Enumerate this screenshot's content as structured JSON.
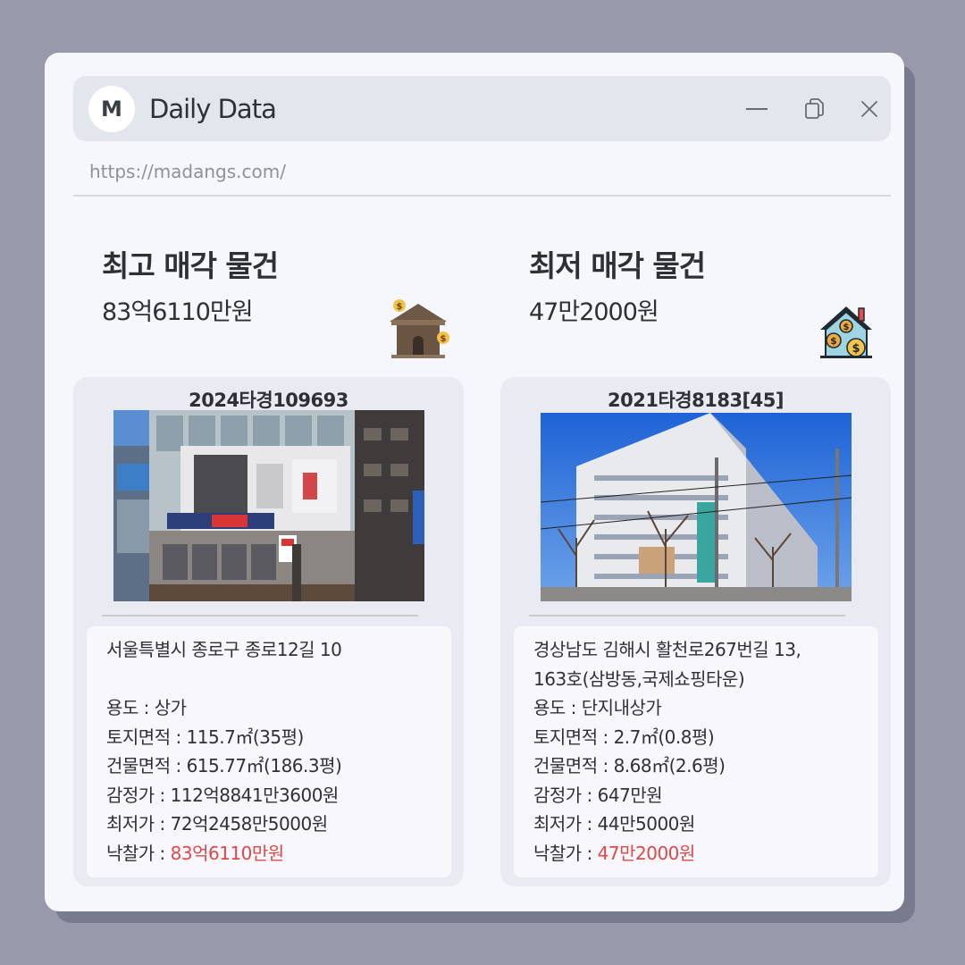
{
  "window": {
    "logo_letter": "M",
    "title": "Daily Data",
    "url": "https://madangs.com/"
  },
  "highest": {
    "title": "최고 매각 물건",
    "value": "83억6110만원",
    "icon": "house-money-icon",
    "case_no": "2024타경109693",
    "address": "서울특별시 종로구 종로12길 10",
    "address_line2": "",
    "use_label": "용도 : ",
    "use": "상가",
    "land_label": "토지면적 : ",
    "land": "115.7㎡(35평)",
    "building_label": "건물면적 : ",
    "building": "615.77㎡(186.3평)",
    "appraisal_label": "감정가 : ",
    "appraisal": "112억8841만3600원",
    "minimum_label": "최저가 : ",
    "minimum": "72억2458만5000원",
    "winning_label": "낙찰가 : ",
    "winning": "83억6110만원"
  },
  "lowest": {
    "title": "최저 매각 물건",
    "value": "47만2000원",
    "icon": "house-coins-icon",
    "case_no": "2021타경8183[45]",
    "address": "경상남도 김해시 활천로267번길 13,",
    "address_line2": "163호(삼방동,국제쇼핑타운)",
    "use_label": "용도 : ",
    "use": " 단지내상가",
    "land_label": "토지면적 : ",
    "land": "2.7㎡(0.8평)",
    "building_label": "건물면적 : ",
    "building": "8.68㎡(2.6평)",
    "appraisal_label": "감정가 : ",
    "appraisal": "647만원",
    "minimum_label": "최저가 : ",
    "minimum": "44만5000원",
    "winning_label": "낙찰가 : ",
    "winning": "47만2000원"
  },
  "colors": {
    "background": "#989aab",
    "window": "#f6f7fc",
    "card": "#e9eaf2",
    "highlight": "#e04848"
  }
}
